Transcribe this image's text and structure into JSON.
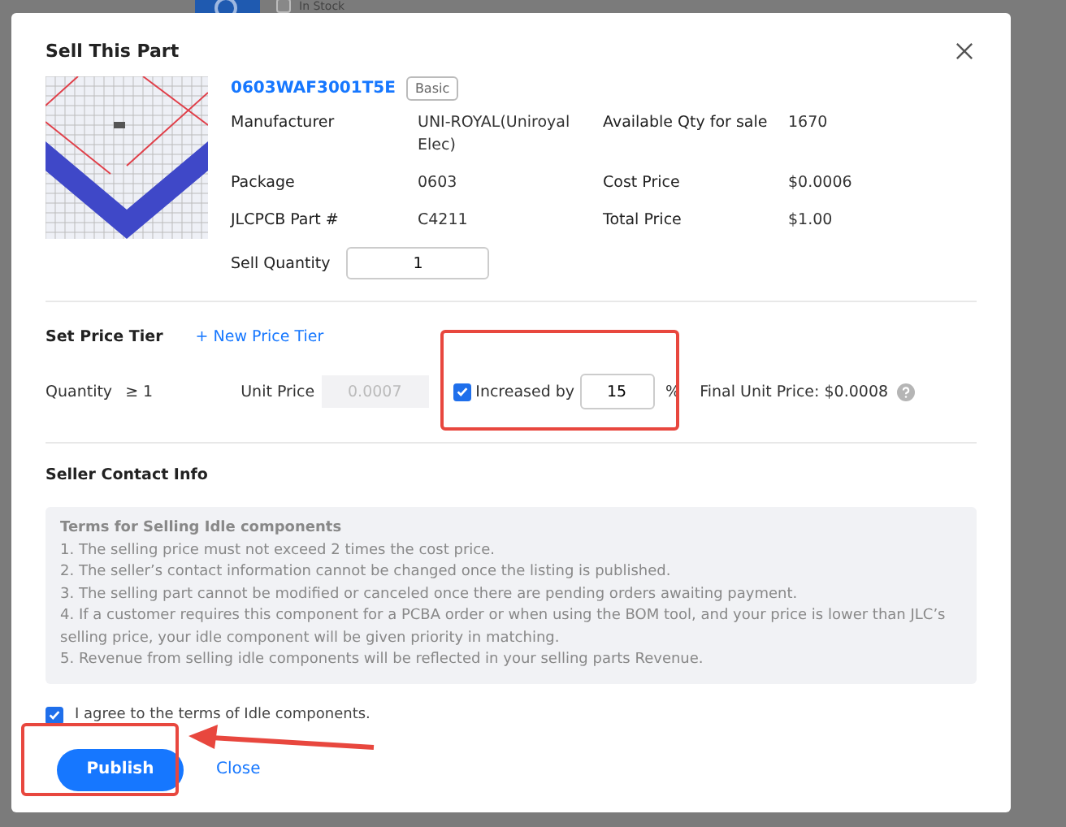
{
  "background": {
    "in_stock_label": "In Stock",
    "in_stock_checked": false
  },
  "dialog": {
    "title": "Sell This Part",
    "part": {
      "number": "0603WAF3001T5E",
      "badge": "Basic",
      "fields": [
        {
          "label": "Manufacturer",
          "value": "UNI-ROYAL(Uniroyal Elec)"
        },
        {
          "label": "Available Qty for sale",
          "value": "1670"
        },
        {
          "label": "Package",
          "value": "0603"
        },
        {
          "label": "Cost Price",
          "value": "$0.0006"
        },
        {
          "label": "JLCPCB Part #",
          "value": "C4211"
        },
        {
          "label": "Total Price",
          "value": "$1.00"
        }
      ],
      "sell_quantity": {
        "label": "Sell Quantity",
        "value": "1"
      }
    },
    "price_tier": {
      "title": "Set Price Tier",
      "add_link": "+ New Price Tier",
      "quantity_label": "Quantity",
      "quantity_value": "≥ 1",
      "unit_price_label": "Unit Price",
      "unit_price_placeholder": "0.0007",
      "increase": {
        "label": "Increased by",
        "checked": true,
        "value": "15",
        "unit": "%"
      },
      "final_price": "Final Unit Price: $0.0008"
    },
    "contact": {
      "title": "Seller Contact Info"
    },
    "terms": {
      "title": "Terms for Selling Idle components",
      "items": [
        "1. The selling price must not exceed 2 times the cost price.",
        "2. The seller’s contact information cannot be changed once the listing is published.",
        "3. The selling part cannot be modified or canceled once there are pending orders awaiting payment.",
        "4. If a customer requires this component for a PCBA order or when using the BOM tool, and your price is lower than JLC’s selling price, your idle component will be given priority in matching.",
        "5. Revenue from selling idle components will be reflected in your selling parts Revenue."
      ]
    },
    "agree": {
      "label": "I agree to the terms of Idle components.",
      "checked": true
    },
    "buttons": [
      {
        "label": "Publish",
        "kind": "primary"
      },
      {
        "label": "Close",
        "kind": "link"
      }
    ]
  }
}
